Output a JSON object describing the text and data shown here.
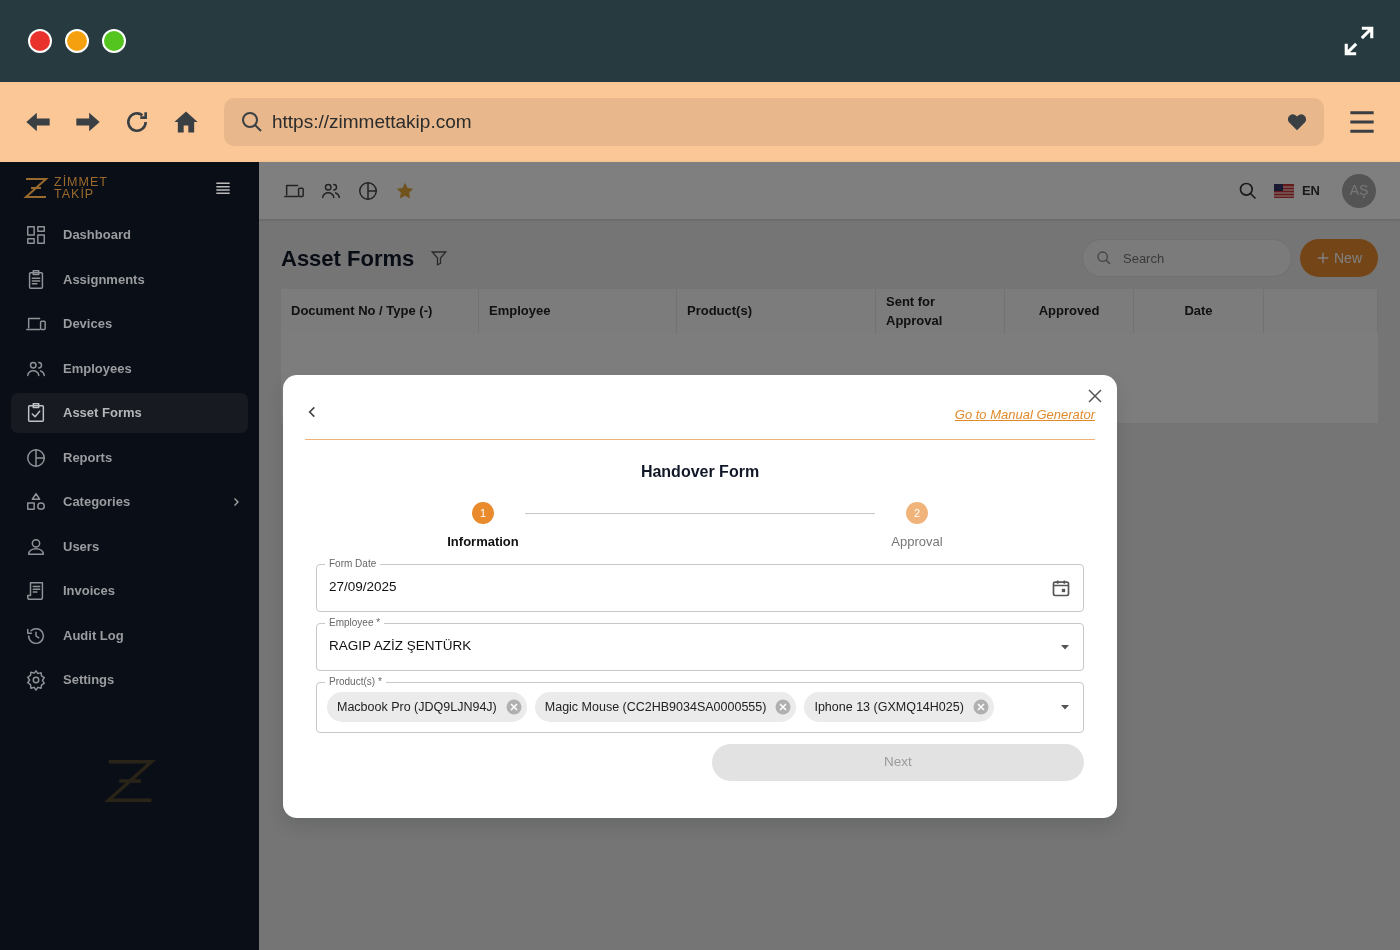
{
  "browser": {
    "window_buttons": [
      {
        "color": "#e8322b"
      },
      {
        "color": "#f5a10f"
      },
      {
        "color": "#54c51f"
      }
    ],
    "url": "https://zimmettakip.com"
  },
  "sidebar": {
    "logo": [
      "ZİMMET",
      "TAKİP"
    ],
    "items": [
      {
        "label": "Dashboard",
        "selected": false,
        "expandable": false
      },
      {
        "label": "Assignments",
        "selected": false,
        "expandable": false
      },
      {
        "label": "Devices",
        "selected": false,
        "expandable": false
      },
      {
        "label": "Employees",
        "selected": false,
        "expandable": false
      },
      {
        "label": "Asset Forms",
        "selected": true,
        "expandable": false
      },
      {
        "label": "Reports",
        "selected": false,
        "expandable": false
      },
      {
        "label": "Categories",
        "selected": false,
        "expandable": true
      },
      {
        "label": "Users",
        "selected": false,
        "expandable": false
      },
      {
        "label": "Invoices",
        "selected": false,
        "expandable": false
      },
      {
        "label": "Audit Log",
        "selected": false,
        "expandable": false
      },
      {
        "label": "Settings",
        "selected": false,
        "expandable": false
      }
    ]
  },
  "topbar": {
    "language": "EN",
    "avatar": "AŞ"
  },
  "page": {
    "title": "Asset Forms",
    "search": {
      "placeholder": "Search"
    },
    "new_button": "New",
    "table": {
      "columns": [
        "Document No / Type (-)",
        "Employee",
        "Product(s)",
        "Sent for Approval",
        "Approved",
        "Date"
      ]
    }
  },
  "modal": {
    "link": "Go to Manual Generator",
    "title": "Handover Form",
    "steps": [
      {
        "number": "1",
        "label": "Information",
        "selected": true
      },
      {
        "number": "2",
        "label": "Approval",
        "selected": false
      }
    ],
    "fields": [
      {
        "kind": "date",
        "label": "Form Date",
        "value": "27/09/2025"
      },
      {
        "kind": "select",
        "label": "Employee *",
        "value": "RAGIP AZİZ ŞENTÜRK"
      },
      {
        "kind": "multiselect",
        "label": "Product(s) *",
        "chips": [
          "Macbook Pro (JDQ9LJN94J)",
          "Magic Mouse (CC2HB9034SA0000555)",
          "Iphone 13 (GXMQ14H025)"
        ]
      }
    ],
    "next_button": {
      "label": "Next",
      "disabled": true
    }
  }
}
